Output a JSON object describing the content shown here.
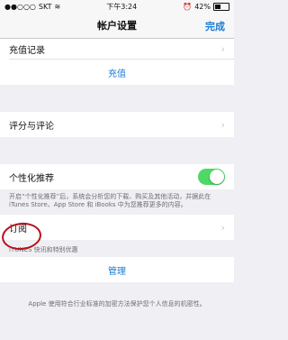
{
  "status": {
    "carrier": "SKT",
    "time": "下午3:24",
    "battery": "42%"
  },
  "nav": {
    "title": "帐户设置",
    "done": "完成"
  },
  "rows": {
    "recharge_record": "充值记录",
    "recharge": "充值",
    "ratings": "评分与评论",
    "personalized": "个性化推荐",
    "personalized_note": "开启“个性化推荐”后，系统会分析您的下载、购买及其他活动，并据此在 iTunes Store、App Store 和 iBooks 中为您推荐更多的内容。",
    "subscriptions": "订阅",
    "itunes_header": "iTUNES 快讯和特别优惠",
    "manage": "管理",
    "bottom_note": "Apple 使用符合行业标准的加密方法保护您个人信息的机密性。"
  },
  "colors": {
    "accent": "#1a7bd3",
    "toggle_on": "#4cd964",
    "annotation": "#b5121b"
  }
}
